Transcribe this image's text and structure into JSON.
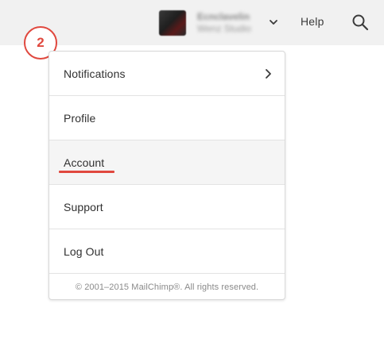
{
  "header": {
    "account_name": "Ecnclavelin",
    "account_org": "Wenz Studio",
    "help_label": "Help",
    "icons": {
      "account_dropdown": "chevron-down-icon",
      "search": "search-icon"
    }
  },
  "step_badge": "2",
  "menu": {
    "items": [
      {
        "label": "Notifications",
        "has_submenu": true,
        "icon": "chevron-right-icon"
      },
      {
        "label": "Profile"
      },
      {
        "label": "Account",
        "selected": true
      },
      {
        "label": "Support"
      },
      {
        "label": "Log Out"
      }
    ],
    "footer": "© 2001–2015 MailChimp®. All rights reserved."
  },
  "colors": {
    "accent": "#e0483e",
    "topbar_bg": "#f1f1f1",
    "text": "#303030",
    "muted_text": "#8a8a8a",
    "border": "#d9d9d9",
    "selected_bg": "#f5f5f5"
  }
}
